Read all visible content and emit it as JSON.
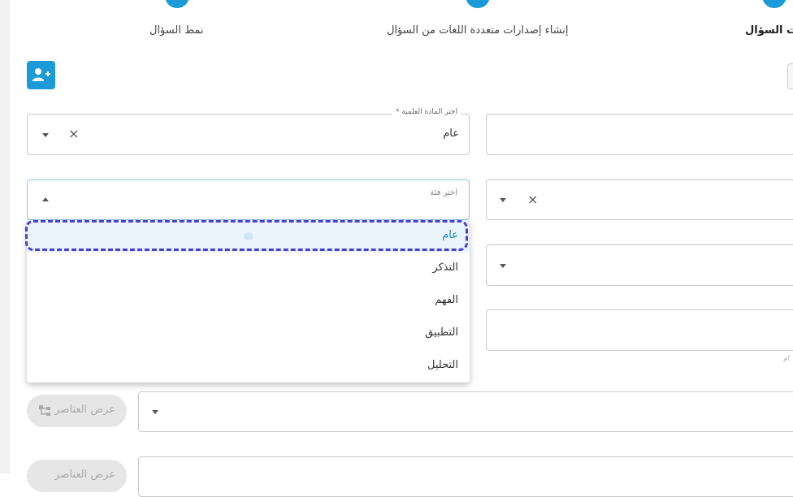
{
  "stepper": {
    "step1_label": "نمط السؤال",
    "step2_label": "إنشاء إصدارات متعددة اللغات من السؤال",
    "step3_label": "ت السؤال"
  },
  "subject_field": {
    "label": "اختر المادة العلمية *",
    "value": "عام"
  },
  "category_field": {
    "placeholder": "اختر فئة",
    "options": [
      "عام",
      "التذكر",
      "الفهم",
      "التطبيق",
      "التحليل"
    ]
  },
  "side_text": "ام",
  "view_elements_button": {
    "label": "عرض العناصر",
    "partial_label": "عرض العناصر"
  },
  "colors": {
    "accent": "#1a9ad6",
    "focus_ring": "#4a3fd0",
    "selected_bg": "#eaf4fb"
  }
}
